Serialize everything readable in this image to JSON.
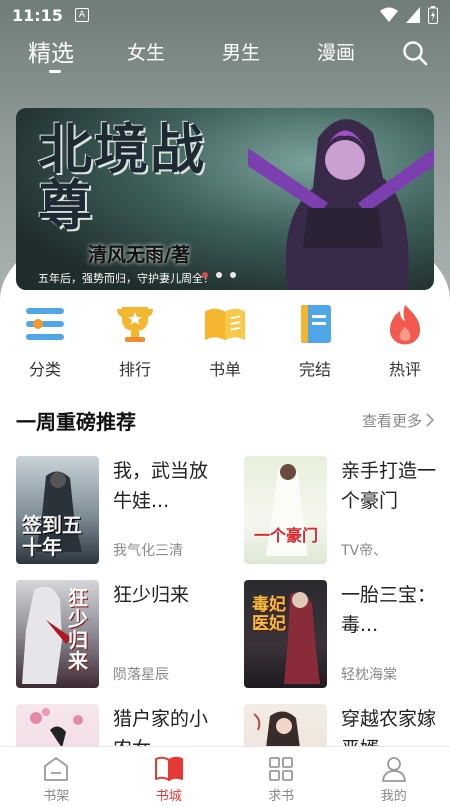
{
  "status": {
    "time": "11:15",
    "notif": "A"
  },
  "tabs": [
    {
      "label": "精选",
      "active": true
    },
    {
      "label": "女生",
      "active": false
    },
    {
      "label": "男生",
      "active": false
    },
    {
      "label": "漫画",
      "active": false
    }
  ],
  "banner": {
    "title": "北境战尊",
    "author": "清风无雨/著",
    "tagline": "五年后，强势而归，守护妻儿周全！",
    "page_count": 3,
    "active_index": 0
  },
  "categories": [
    {
      "label": "分类",
      "icon": "category-icon"
    },
    {
      "label": "排行",
      "icon": "trophy-icon"
    },
    {
      "label": "书单",
      "icon": "book-list-icon"
    },
    {
      "label": "完结",
      "icon": "finished-book-icon"
    },
    {
      "label": "热评",
      "icon": "flame-icon"
    }
  ],
  "section": {
    "title": "一周重磅推荐",
    "more": "查看更多"
  },
  "books": [
    {
      "title": "我，武当放牛娃...",
      "author": "我气化三清",
      "cover_text": "签到五十年"
    },
    {
      "title": "亲手打造一个豪门",
      "author": "TV帝、",
      "cover_text": "一个豪门"
    },
    {
      "title": "狂少归来",
      "author": "陨落星辰",
      "cover_text": "狂少归来"
    },
    {
      "title": "一胎三宝：毒...",
      "author": "轻枕海棠",
      "cover_text": "毒妃医妃"
    },
    {
      "title": "猎户家的小农女",
      "author": "",
      "cover_text": ""
    },
    {
      "title": "穿越农家嫁恶婿",
      "author": "",
      "cover_text": ""
    }
  ],
  "nav": [
    {
      "label": "书架",
      "icon": "bookshelf-icon",
      "active": false
    },
    {
      "label": "书城",
      "icon": "bookstore-icon",
      "active": true
    },
    {
      "label": "求书",
      "icon": "request-book-icon",
      "active": false
    },
    {
      "label": "我的",
      "icon": "profile-icon",
      "active": false
    }
  ],
  "colors": {
    "accent": "#e53935",
    "header_bg": "#7d8985"
  }
}
